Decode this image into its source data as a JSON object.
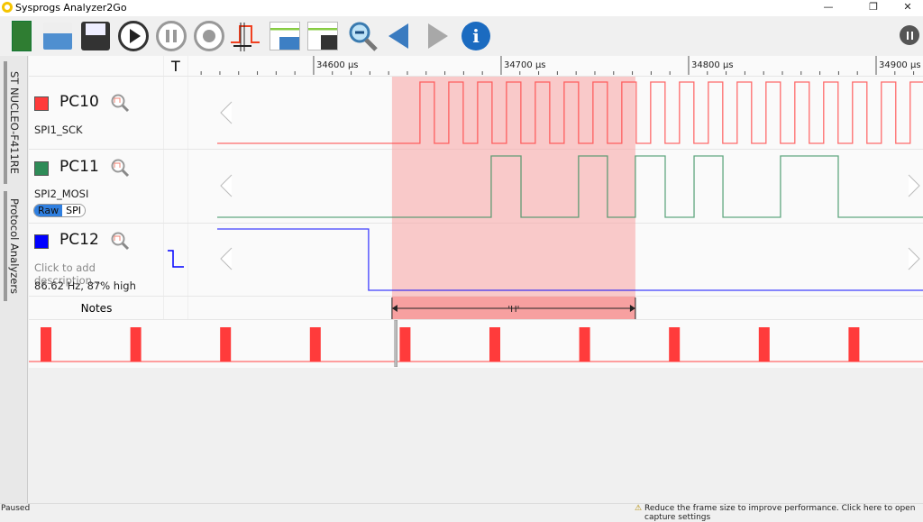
{
  "window": {
    "title": "Sysprogs Analyzer2Go",
    "controls": [
      "minimize",
      "restore",
      "close"
    ]
  },
  "toolbar": {
    "buttons": [
      "board-icon",
      "open-icon",
      "save-icon",
      "play-icon",
      "pause-icon",
      "record-icon",
      "pulse-measure-icon",
      "open-settings-icon",
      "save-settings-icon",
      "zoom-out-icon",
      "previous-icon",
      "next-icon",
      "info-icon"
    ],
    "status_indicator": "paused-icon"
  },
  "side_tabs": [
    "ST NUCLEO-F411RE",
    "Protocol Analyzers"
  ],
  "timeline": {
    "trigger_label": "T",
    "ticks": [
      "34600 µs",
      "34700 µs",
      "34800 µs",
      "34900 µs"
    ],
    "tick_values_us": [
      34600,
      34700,
      34800,
      34900
    ],
    "view_range_us": [
      34533.2,
      34925
    ]
  },
  "channels": [
    {
      "pin": "PC10",
      "name": "SPI1_SCK",
      "color": "#ff3b3b"
    },
    {
      "pin": "PC11",
      "name": "SPI2_MOSI",
      "color": "#2e8b57",
      "toggle": [
        "Raw",
        "SPI"
      ],
      "toggle_selected": "Raw"
    },
    {
      "pin": "PC12",
      "name": "Click to add description...",
      "color": "#0000ff",
      "stats": "86.62 Hz, 87% high"
    }
  ],
  "signals": {
    "sck": {
      "first_rise_us": 34656.7,
      "period_us": 15.38
    },
    "mosi": {
      "initial": 0,
      "edges_us": [
        34694.7,
        34710.6,
        34741.3,
        34756.7,
        34771.6,
        34787.5,
        34802.9,
        34818.3,
        34849.0,
        34879.8
      ]
    },
    "pc12": {
      "initial": 1,
      "edges_us": [
        34629.3
      ]
    }
  },
  "selection": {
    "start_us": 34641.8,
    "end_us": 34771.6,
    "color": "#f7a0a0"
  },
  "notes": {
    "label": "Notes",
    "annotation": "'H'"
  },
  "overview": {
    "pulse_count": 10,
    "cursor_fraction": 0.41
  },
  "status": {
    "left": "Paused",
    "right": "Reduce the frame size to improve performance. Click here to open capture settings"
  }
}
